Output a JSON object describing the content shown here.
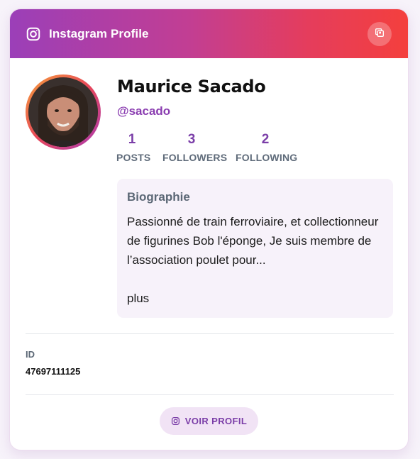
{
  "header": {
    "title": "Instagram Profile",
    "icon": "instagram-icon",
    "copy_icon": "copy-icon"
  },
  "profile": {
    "name": "Maurice Sacado",
    "handle": "@sacado",
    "avatar": "profile-photo"
  },
  "stats": [
    {
      "value": "1",
      "label": "POSTS"
    },
    {
      "value": "3",
      "label": "FOLLOWERS"
    },
    {
      "value": "2",
      "label": "FOLLOWING"
    }
  ],
  "bio": {
    "title": "Biographie",
    "text": "Passionné de train ferroviaire, et collectionneur de figurines Bob l'éponge, Je suis membre de l’association poulet pour...",
    "more": "plus"
  },
  "details": {
    "id_label": "ID",
    "id_value": "47697111125"
  },
  "actions": {
    "view_profile_label": "VOIR PROFIL",
    "view_profile_icon": "instagram-icon"
  },
  "colors": {
    "gradient_start": "#9b3fb8",
    "gradient_end": "#f43f3d",
    "accent": "#7b3ea8",
    "bio_background": "#f7f2fa"
  }
}
